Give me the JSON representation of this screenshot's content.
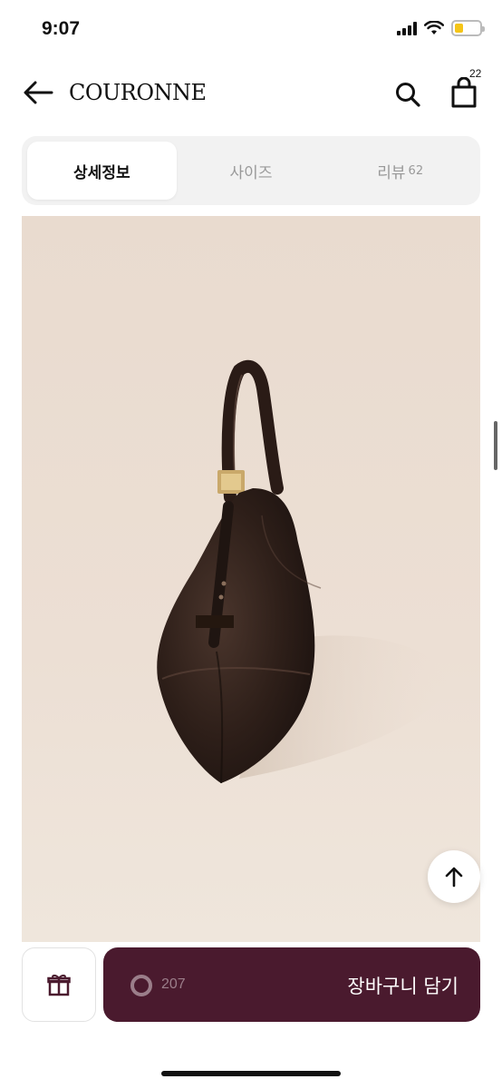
{
  "status_bar": {
    "time": "9:07",
    "battery_level": 0.35,
    "battery_color": "#f5c518"
  },
  "header": {
    "back_icon": "arrow-left-icon",
    "brand": "COURONNE",
    "search_icon": "search-icon",
    "cart_icon": "shopping-bag-icon",
    "cart_count": "22"
  },
  "tabs": [
    {
      "label": "상세정보",
      "count": "",
      "active": true
    },
    {
      "label": "사이즈",
      "count": "",
      "active": false
    },
    {
      "label": "리뷰",
      "count": "62",
      "active": false
    }
  ],
  "product": {
    "image": "brown-leather-hobo-bag-photo"
  },
  "scroll_top": {
    "icon": "arrow-up-icon"
  },
  "bottom_bar": {
    "gift_icon": "gift-icon",
    "like_icon": "ring-icon",
    "like_count": "207",
    "add_to_cart_label": "장바구니 담기",
    "accent_color": "#4a1a2e"
  }
}
